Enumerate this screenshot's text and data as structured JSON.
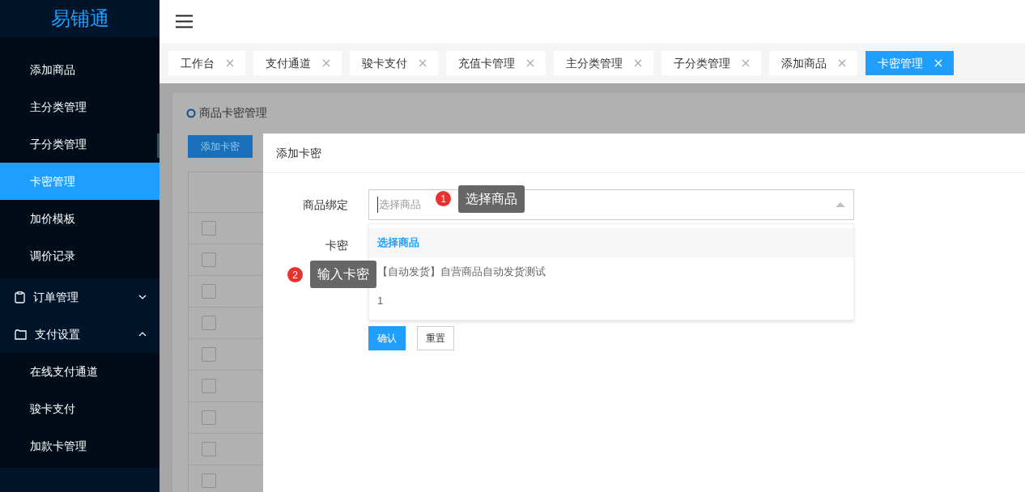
{
  "header": {
    "logo": "易铺通"
  },
  "sidebar": {
    "items": [
      {
        "label": "添加商品",
        "selected": false
      },
      {
        "label": "主分类管理",
        "selected": false
      },
      {
        "label": "子分类管理",
        "selected": false
      },
      {
        "label": "卡密管理",
        "selected": true
      },
      {
        "label": "加价模板",
        "selected": false
      },
      {
        "label": "调价记录",
        "selected": false
      }
    ],
    "groups": [
      {
        "label": "订单管理",
        "expanded": false
      },
      {
        "label": "支付设置",
        "expanded": true,
        "children": [
          {
            "label": "在线支付通道",
            "selected": false
          },
          {
            "label": "骏卡支付",
            "selected": false
          },
          {
            "label": "加款卡管理",
            "selected": false
          }
        ]
      }
    ]
  },
  "tabs": [
    {
      "label": "工作台",
      "selected": false
    },
    {
      "label": "支付通道",
      "selected": false
    },
    {
      "label": "骏卡支付",
      "selected": false
    },
    {
      "label": "充值卡管理",
      "selected": false
    },
    {
      "label": "主分类管理",
      "selected": false
    },
    {
      "label": "子分类管理",
      "selected": false
    },
    {
      "label": "添加商品",
      "selected": false
    },
    {
      "label": "卡密管理",
      "selected": true
    }
  ],
  "page": {
    "title": "商品卡密管理",
    "add_button": "添加卡密",
    "table": {
      "rows": [
        {
          "checked": false
        },
        {
          "checked": false
        },
        {
          "checked": false
        },
        {
          "checked": false
        },
        {
          "checked": false
        },
        {
          "checked": false
        },
        {
          "checked": false
        },
        {
          "checked": false
        },
        {
          "checked": false
        }
      ]
    }
  },
  "dialog": {
    "title": "添加卡密",
    "fields": [
      {
        "label": "商品绑定",
        "kind": "select",
        "placeholder": "选择商品",
        "expanded": true
      },
      {
        "label": "卡密",
        "kind": "text"
      }
    ],
    "options": [
      {
        "label": "选择商品",
        "selected": true
      },
      {
        "label": "【自动发货】自营商品自动发货测试",
        "selected": false
      },
      {
        "label": "1",
        "selected": false
      }
    ],
    "buttons": [
      {
        "label": "确认",
        "kind": "primary"
      },
      {
        "label": "重置",
        "kind": "default"
      }
    ]
  },
  "annotations": [
    {
      "number": "1",
      "text": "选择商品"
    },
    {
      "number": "2",
      "text": "输入卡密"
    }
  ]
}
